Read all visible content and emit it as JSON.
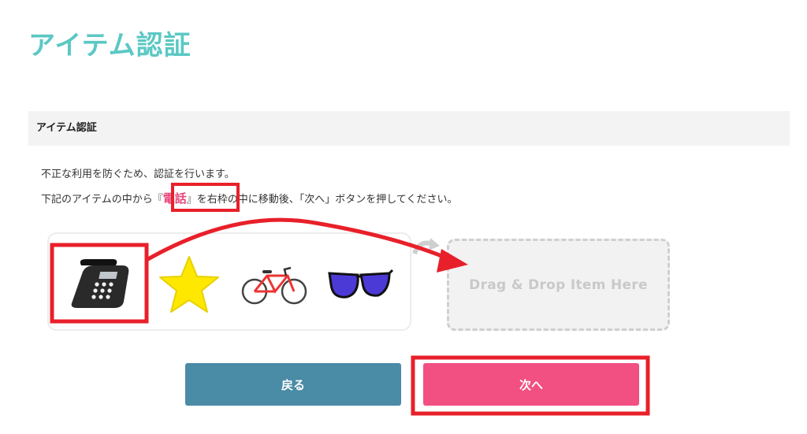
{
  "page": {
    "title": "アイテム認証"
  },
  "section": {
    "header": "アイテム認証"
  },
  "instructions": {
    "line1": "不正な利用を防ぐため、認証を行います。",
    "line2_before": "下記のアイテムの中から",
    "quote_open": "『",
    "target_word": "電話",
    "quote_close": "』",
    "line2_after": "を右枠の中に移動後、「次へ」ボタンを押してください。"
  },
  "items": [
    {
      "icon": "telephone-icon"
    },
    {
      "icon": "star-icon"
    },
    {
      "icon": "bicycle-icon"
    },
    {
      "icon": "sunglasses-icon"
    }
  ],
  "drop_zone": {
    "label": "Drag & Drop  Item Here"
  },
  "buttons": {
    "back_label": "戻る",
    "next_label": "次へ"
  },
  "colors": {
    "title": "#5bc8c4",
    "highlight_word": "#e8457a",
    "back_button": "#4a8ba5",
    "next_button": "#f24f82",
    "annotation_red": "#e8202a"
  }
}
